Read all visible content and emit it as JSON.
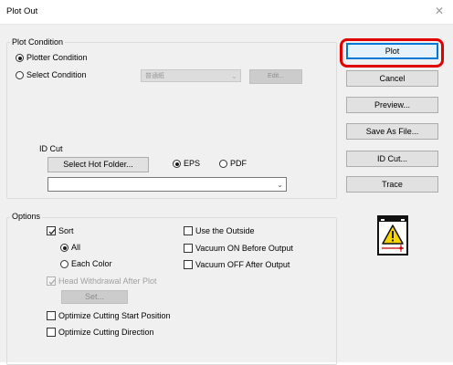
{
  "window": {
    "title": "Plot Out"
  },
  "plot_condition": {
    "label": "Plot Condition",
    "plotter_condition": "Plotter Condition",
    "select_condition": "Select Condition",
    "select_condition_value": "普通紙",
    "edit_button": "Edit..."
  },
  "id_cut": {
    "label": "ID Cut",
    "select_hot_folder": "Select Hot Folder...",
    "eps": "EPS",
    "pdf": "PDF",
    "folder_value": ""
  },
  "options": {
    "label": "Options",
    "sort": "Sort",
    "all": "All",
    "each_color": "Each Color",
    "head_withdrawal": "Head Withdrawal After Plot",
    "set_button": "Set...",
    "optimize_start": "Optimize Cutting Start Position",
    "optimize_direction": "Optimize Cutting Direction",
    "use_outside": "Use the Outside",
    "vacuum_on": "Vacuum ON Before Output",
    "vacuum_off": "Vacuum OFF After Output"
  },
  "buttons": {
    "plot": "Plot",
    "cancel": "Cancel",
    "preview": "Preview...",
    "save_as_file": "Save As File...",
    "id_cut": "ID Cut...",
    "trace": "Trace"
  },
  "colors": {
    "highlight": "#e00000",
    "default_button_border": "#0078d7"
  }
}
